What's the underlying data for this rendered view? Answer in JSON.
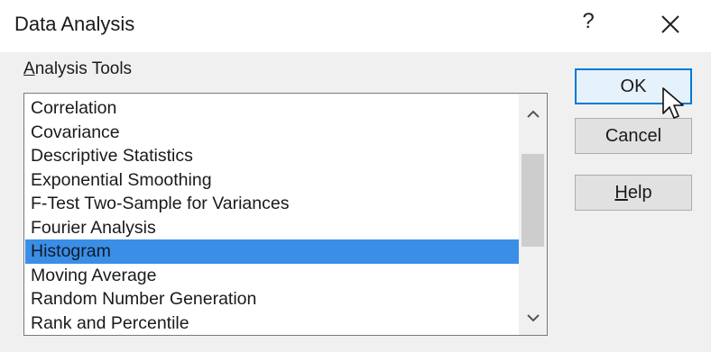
{
  "dialog": {
    "title": "Data Analysis",
    "help_glyph": "?"
  },
  "analysis_tools": {
    "label_accel": "A",
    "label_rest": "nalysis Tools",
    "items": [
      "Correlation",
      "Covariance",
      "Descriptive Statistics",
      "Exponential Smoothing",
      "F-Test Two-Sample for Variances",
      "Fourier Analysis",
      "Histogram",
      "Moving Average",
      "Random Number Generation",
      "Rank and Percentile"
    ],
    "selected_index": 6
  },
  "buttons": {
    "ok": "OK",
    "cancel": "Cancel",
    "help_accel": "H",
    "help_rest": "elp"
  },
  "icons": {
    "close": "close-icon",
    "scroll_up": "chevron-up-icon",
    "scroll_down": "chevron-down-icon",
    "cursor": "mouse-pointer-icon"
  },
  "colors": {
    "selection": "#3a8ee6",
    "ok_border": "#0078d7"
  }
}
